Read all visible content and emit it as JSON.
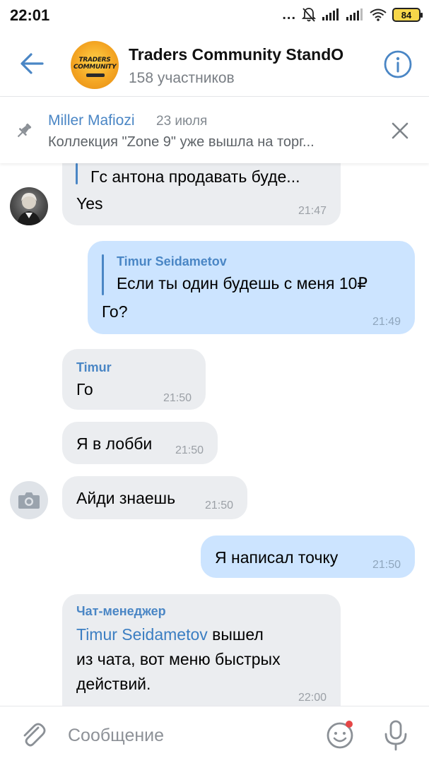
{
  "status_bar": {
    "time": "22:01",
    "dots": "...",
    "battery": "84"
  },
  "header": {
    "title": "Traders Community StandO",
    "subtitle": "158 участников",
    "avatar_logo_line1": "TRADERS",
    "avatar_logo_line2": "COMMUNITY"
  },
  "pinned": {
    "author": "Miller Mafiozi",
    "date": "23 июля",
    "text": "Коллекция \"Zone 9\" уже вышла на торг..."
  },
  "messages": [
    {
      "id": "m1",
      "direction": "incoming",
      "quote_text": "Гс антона продавать буде...",
      "text": "Yes",
      "time": "21:47"
    },
    {
      "id": "m2",
      "direction": "outgoing",
      "quote_name": "Timur Seidametov",
      "quote_text": "Если ты один будешь с меня 10₽",
      "text": "Го?",
      "time": "21:49"
    },
    {
      "id": "m3",
      "direction": "incoming",
      "sender": "Timur",
      "text": "Го",
      "time": "21:50"
    },
    {
      "id": "m4",
      "direction": "incoming",
      "text": "Я в лобби",
      "time": "21:50"
    },
    {
      "id": "m5",
      "direction": "incoming",
      "text": "Айди знаешь",
      "time": "21:50"
    },
    {
      "id": "m6",
      "direction": "outgoing",
      "text": "Я написал точку",
      "time": "21:50"
    },
    {
      "id": "m7",
      "direction": "incoming",
      "sender": "Чат-менеджер",
      "link_text": "Timur Seidametov",
      "text_after_link": " вышел",
      "line2": "из чата, вот меню быстрых",
      "line3": "действий.",
      "time": "22:00"
    }
  ],
  "composer": {
    "placeholder": "Сообщение"
  },
  "colors": {
    "accent": "#4a86c5",
    "incoming_bubble": "#ebedf0",
    "outgoing_bubble": "#cce4ff",
    "notification_dot": "#e64646"
  }
}
